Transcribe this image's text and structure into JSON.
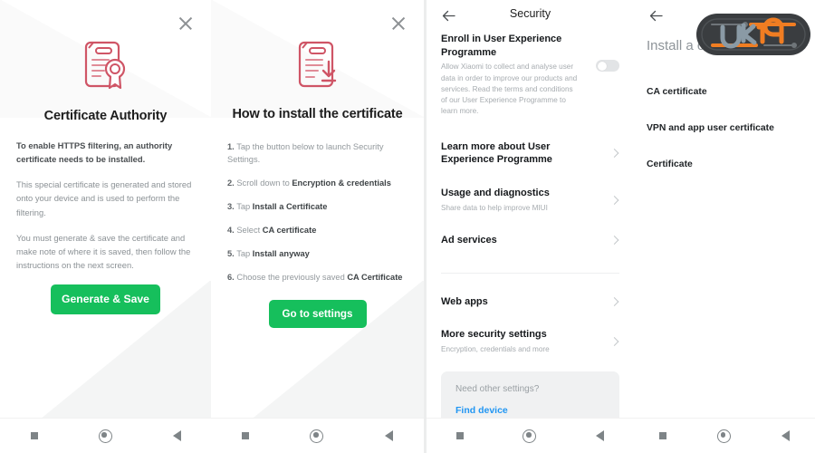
{
  "panel1": {
    "close_icon": "close-icon",
    "cert_icon": "certificate-seal-icon",
    "title": "Certificate Authority",
    "lead": "To enable HTTPS filtering, an authority certificate needs to be installed.",
    "paragraph1": "This special certificate is generated and stored onto your device and is used to perform the filtering.",
    "paragraph2": "You must generate & save the certificate and make note of where it is saved, then follow the instructions on the next screen.",
    "button_label": "Generate & Save",
    "button_color": "#16bf5c"
  },
  "panel2": {
    "close_icon": "close-icon",
    "cert_icon": "certificate-download-icon",
    "title": "How to install the certificate",
    "steps": [
      {
        "num": "1.",
        "pre": "Tap the button below to launch Security Settings.",
        "strong": "",
        "post": ""
      },
      {
        "num": "2.",
        "pre": "Scroll down to ",
        "strong": "Encryption & credentials",
        "post": ""
      },
      {
        "num": "3.",
        "pre": "Tap ",
        "strong": "Install a Certificate",
        "post": ""
      },
      {
        "num": "4.",
        "pre": "Select ",
        "strong": "CA certificate",
        "post": ""
      },
      {
        "num": "5.",
        "pre": "Tap ",
        "strong": "Install anyway",
        "post": ""
      },
      {
        "num": "6.",
        "pre": "Choose the previously saved ",
        "strong": "CA Certificate",
        "post": ""
      }
    ],
    "button_label": "Go to settings",
    "button_color": "#16bf5c"
  },
  "panel3": {
    "back_icon": "back-arrow-icon",
    "title": "Security",
    "enroll": {
      "title": "Enroll in User Experience Programme",
      "subtitle": "Allow Xiaomi to collect and analyse user data in order to improve our products and services. Read the terms and conditions of our User Experience Programme to learn more.",
      "toggle_state": "off"
    },
    "rows": [
      {
        "title": "Learn more about User Experience Programme",
        "subtitle": "",
        "chevron": true
      },
      {
        "title": "Usage and diagnostics",
        "subtitle": "Share data to help improve MIUI",
        "chevron": true
      },
      {
        "title": "Ad services",
        "subtitle": "",
        "chevron": true
      }
    ],
    "rows2": [
      {
        "title": "Web apps",
        "subtitle": "",
        "chevron": true
      },
      {
        "title": "More security settings",
        "subtitle": "Encryption, credentials and more",
        "chevron": true
      }
    ],
    "info_card": {
      "question": "Need other settings?",
      "link": "Find device",
      "link_color": "#2196f3"
    }
  },
  "panel4": {
    "back_icon": "back-arrow-icon",
    "title": "Install a certificate",
    "items": [
      {
        "label": "CA certificate"
      },
      {
        "label": "VPN and app user certificate"
      },
      {
        "label": "Certificate"
      }
    ]
  },
  "navbar": {
    "recents_icon": "recents-square-icon",
    "home_icon": "home-circle-icon",
    "back_icon": "back-triangle-icon"
  },
  "watermark": {
    "name": "ukiq-logo-watermark",
    "text": "UK19",
    "body_color": "#3a3d40",
    "accent_color": "#f07d22",
    "letter_color": "#8a9aa5"
  }
}
